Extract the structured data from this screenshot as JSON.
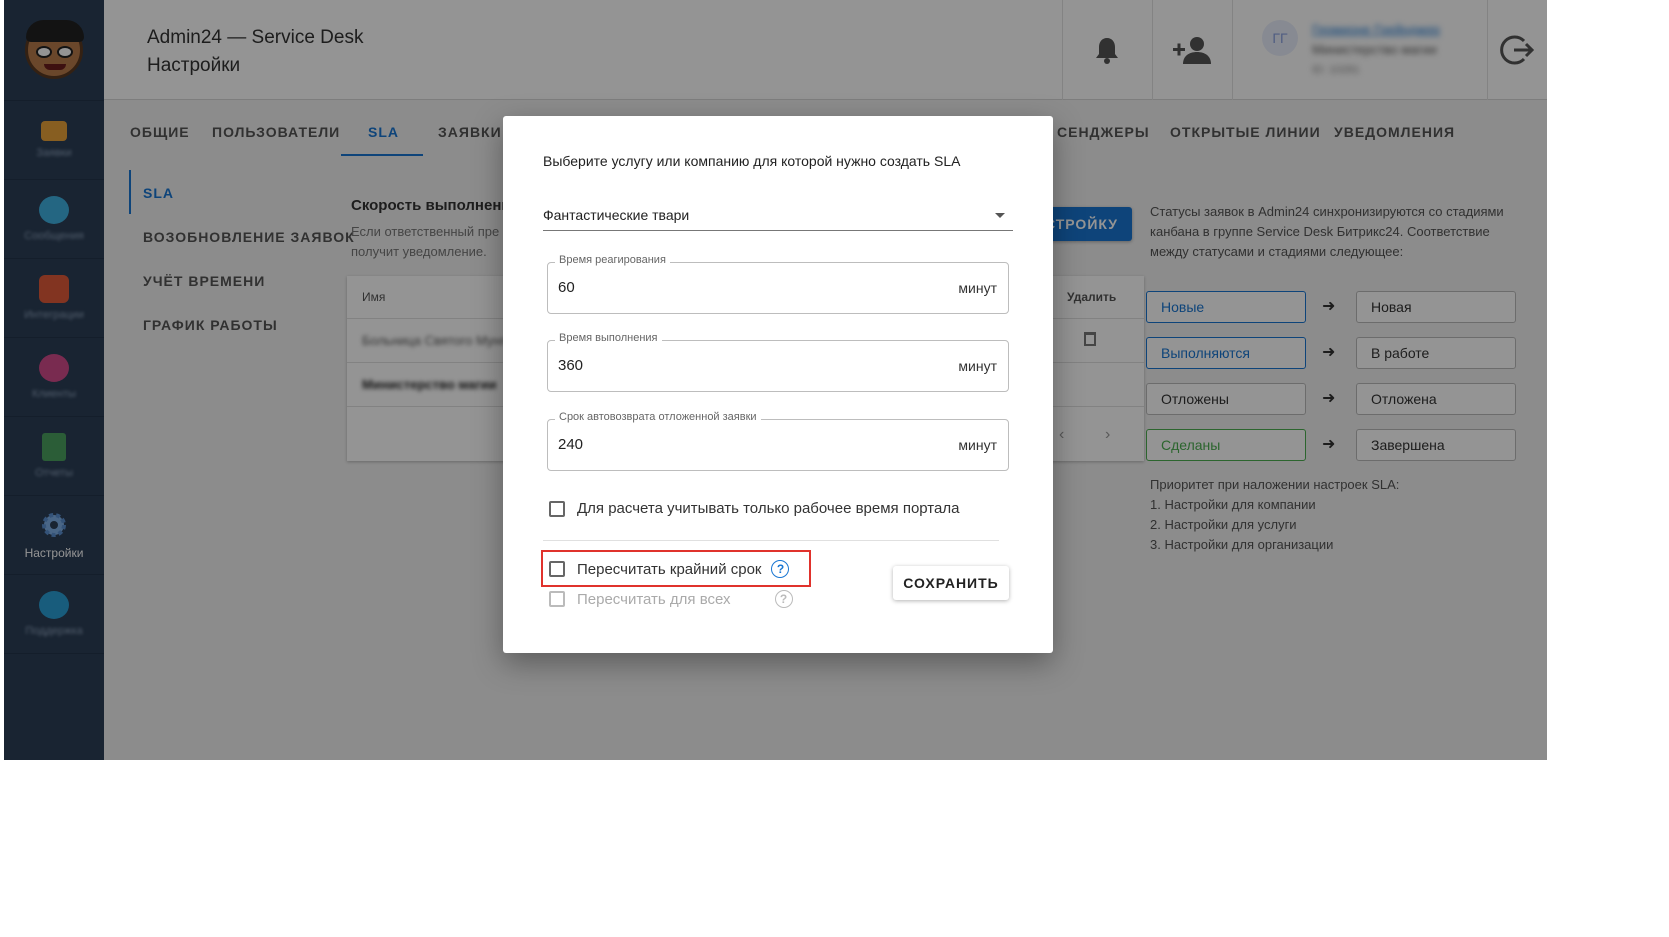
{
  "header": {
    "title_line1": "Admin24 — Service Desk",
    "title_line2": "Настройки",
    "user_initials": "ГГ",
    "user_name": "Гермионе Грейнджер",
    "user_org": "Министерство магии",
    "user_id": "ID: 10281"
  },
  "sidebar": {
    "items": [
      {
        "label": "Заявки",
        "icon": "megaphone-icon",
        "color": "#e8a23a"
      },
      {
        "label": "Сообщения",
        "icon": "chat-icon",
        "color": "#3fb0e0"
      },
      {
        "label": "Интеграции",
        "icon": "puzzle-icon",
        "color": "#e05a3a"
      },
      {
        "label": "Клиенты",
        "icon": "heart-icon",
        "color": "#d04a8a"
      },
      {
        "label": "Отчеты",
        "icon": "report-icon",
        "color": "#4aa060"
      },
      {
        "label": "Настройки",
        "icon": "gear-icon",
        "color": "#7fb0e8"
      },
      {
        "label": "Поддержка",
        "icon": "globe-icon",
        "color": "#2a9fd6"
      }
    ]
  },
  "tabs": [
    "ОБЩИЕ",
    "ПОЛЬЗОВАТЕЛИ",
    "SLA",
    "ЗАЯВКИ",
    "СЕНДЖЕРЫ",
    "ОТКРЫТЫЕ ЛИНИИ",
    "УВЕДОМЛЕНИЯ"
  ],
  "subnav": [
    "SLA",
    "ВОЗОБНОВЛЕНИЕ ЗАЯВОК",
    "УЧЁТ ВРЕМЕНИ",
    "ГРАФИК РАБОТЫ"
  ],
  "background": {
    "speed_title": "Скорость выполнени",
    "speed_desc": "Если ответственный пре получит уведомление.",
    "col_name": "Имя",
    "col_delete": "Удалить",
    "row1": "Больница Святого Мунго",
    "row2": "Министерство магии",
    "blue_button": "СТРОЙКУ",
    "info": "Статусы заявок в Admin24 синхронизируются со стадиями канбана в группе Service Desk Битрикс24. Соответствие между статусами и стадиями следующее:",
    "statuses": [
      {
        "from": "Новые",
        "to": "Новая",
        "color": "#1976d2"
      },
      {
        "from": "Выполняются",
        "to": "В работе",
        "color": "#1976d2"
      },
      {
        "from": "Отложены",
        "to": "Отложена",
        "color": "#333333"
      },
      {
        "from": "Сделаны",
        "to": "Завершена",
        "color": "#4caf50"
      }
    ],
    "priority_title": "Приоритет при наложении настроек SLA:",
    "priority_items": [
      "1. Настройки для компании",
      "2. Настройки для услуги",
      "3. Настройки для организации"
    ]
  },
  "modal": {
    "title": "Выберите услугу или компанию для которой нужно создать SLA",
    "select_value": "Фантастические твари",
    "fields": [
      {
        "label": "Время реагирования",
        "value": "60",
        "unit": "минут"
      },
      {
        "label": "Время выполнения",
        "value": "360",
        "unit": "минут"
      },
      {
        "label": "Срок автовозврата отложенной заявки",
        "value": "240",
        "unit": "минут"
      }
    ],
    "work_time_checkbox": "Для расчета учитывать только рабочее время портала",
    "recalc_deadline": "Пересчитать крайний срок",
    "recalc_all": "Пересчитать для всех",
    "save": "СОХРАНИТЬ"
  }
}
